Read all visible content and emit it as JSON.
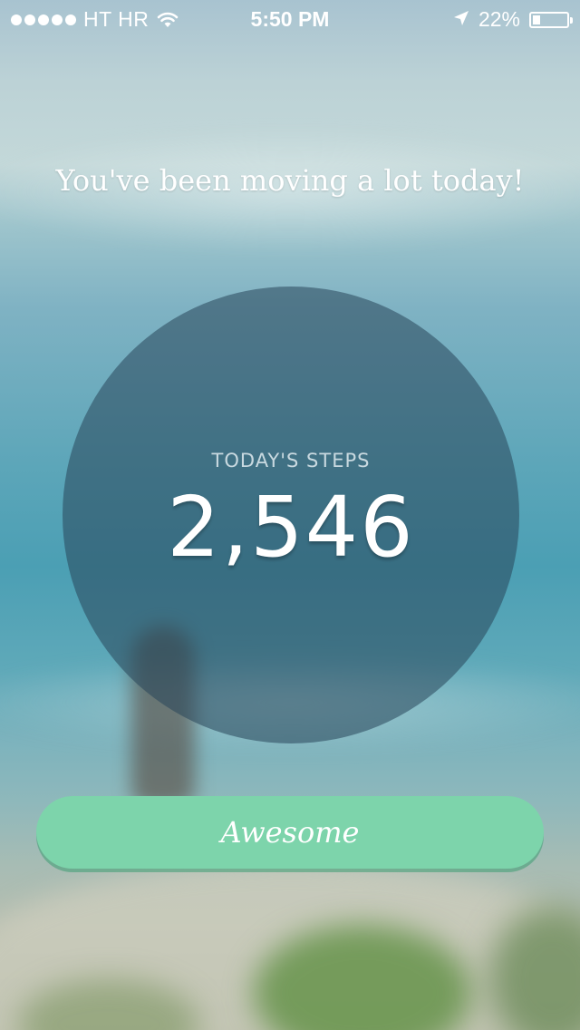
{
  "status_bar": {
    "signal_dots": 5,
    "carrier": "HT HR",
    "wifi_icon": "wifi-icon",
    "time": "5:50 PM",
    "location_icon": "location-arrow-icon",
    "battery_percent_text": "22%",
    "battery_level": 0.22
  },
  "main": {
    "headline": "You've been moving a lot today!",
    "steps_label": "TODAY'S STEPS",
    "steps_value": "2,546"
  },
  "actions": {
    "awesome_label": "Awesome"
  },
  "colors": {
    "button": "#7dd4ab",
    "circle": "rgba(40,70,90,0.55)",
    "text": "#ffffff"
  }
}
